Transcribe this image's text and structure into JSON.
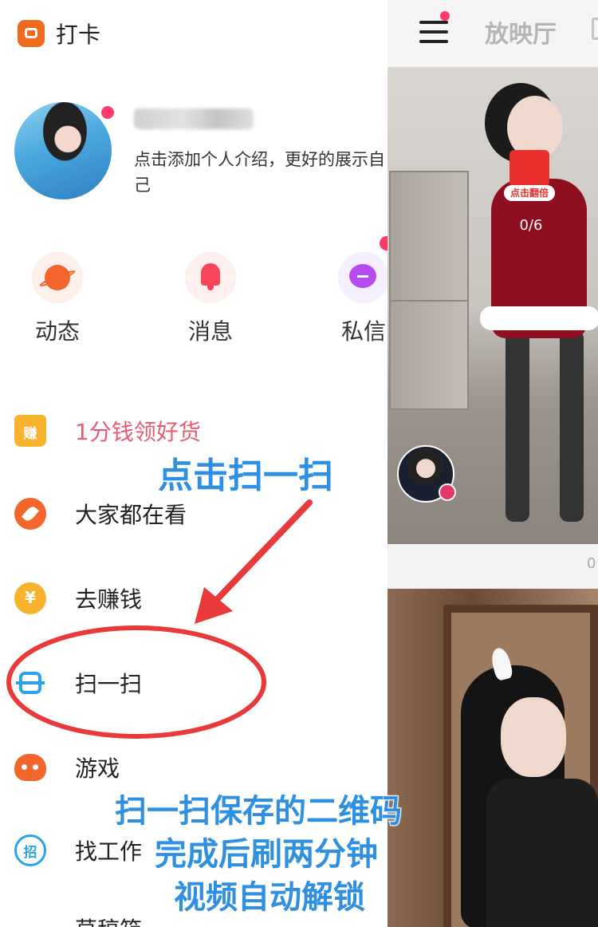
{
  "drawer": {
    "checkin_label": "打卡",
    "profile": {
      "bio": "点击添加个人介绍，更好的展示自己"
    },
    "quick_actions": [
      {
        "label": "动态",
        "icon": "planet-icon"
      },
      {
        "label": "消息",
        "icon": "bell-icon"
      },
      {
        "label": "私信",
        "icon": "chat-bubble-icon"
      }
    ],
    "menu": [
      {
        "label": "1分钱领好货",
        "icon": "shopping-bag-icon",
        "icon_text": "赚"
      },
      {
        "label": "大家都在看",
        "icon": "compass-icon"
      },
      {
        "label": "去赚钱",
        "icon": "coin-icon",
        "icon_text": "¥"
      },
      {
        "label": "扫一扫",
        "icon": "scan-icon"
      },
      {
        "label": "游戏",
        "icon": "gamepad-icon"
      },
      {
        "label": "找工作",
        "icon": "job-icon",
        "icon_text": "招"
      },
      {
        "label": "草稿箱",
        "icon": "folder-icon"
      }
    ]
  },
  "feed": {
    "header_title": "放映厅",
    "card1": {
      "envelope_label": "点击翻倍",
      "progress": "0/6",
      "footer_text": "0"
    }
  },
  "annotations": {
    "title": "点击扫一扫",
    "instructions": [
      "扫一扫保存的二维码",
      "完成后刷两分钟",
      "视频自动解锁"
    ]
  },
  "colors": {
    "accent_orange": "#f2652b",
    "scan_blue": "#2ba3e8",
    "annotation_blue": "#2f8fe0",
    "annotation_red": "#e8393b",
    "notify_pink": "#ff3b6b"
  }
}
